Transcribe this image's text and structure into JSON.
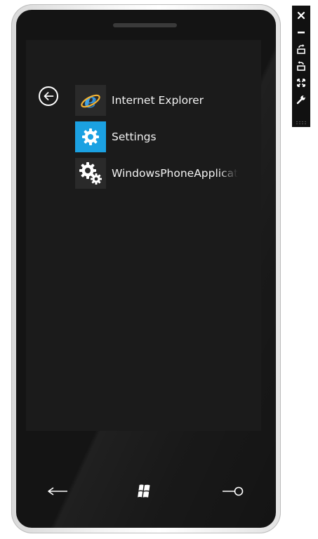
{
  "apps": [
    {
      "label": "Internet Explorer",
      "icon": "internet-explorer-icon",
      "tile_color": "#2a2a2a"
    },
    {
      "label": "Settings",
      "icon": "settings-gear-icon",
      "tile_color": "#1ba1e2"
    },
    {
      "label": "WindowsPhoneApplicat",
      "icon": "app-gears-icon",
      "tile_color": "#2a2a2a"
    }
  ],
  "hardware_buttons": [
    "back-arrow-icon",
    "windows-start-icon",
    "search-icon"
  ],
  "toolbar": [
    "close-icon",
    "minimize-icon",
    "rotate-left-icon",
    "rotate-right-icon",
    "fit-to-screen-icon",
    "tools-wrench-icon"
  ],
  "colors": {
    "accent": "#1ba1e2",
    "screen_background": "#1b1b1b",
    "phone_body": "#141414"
  }
}
